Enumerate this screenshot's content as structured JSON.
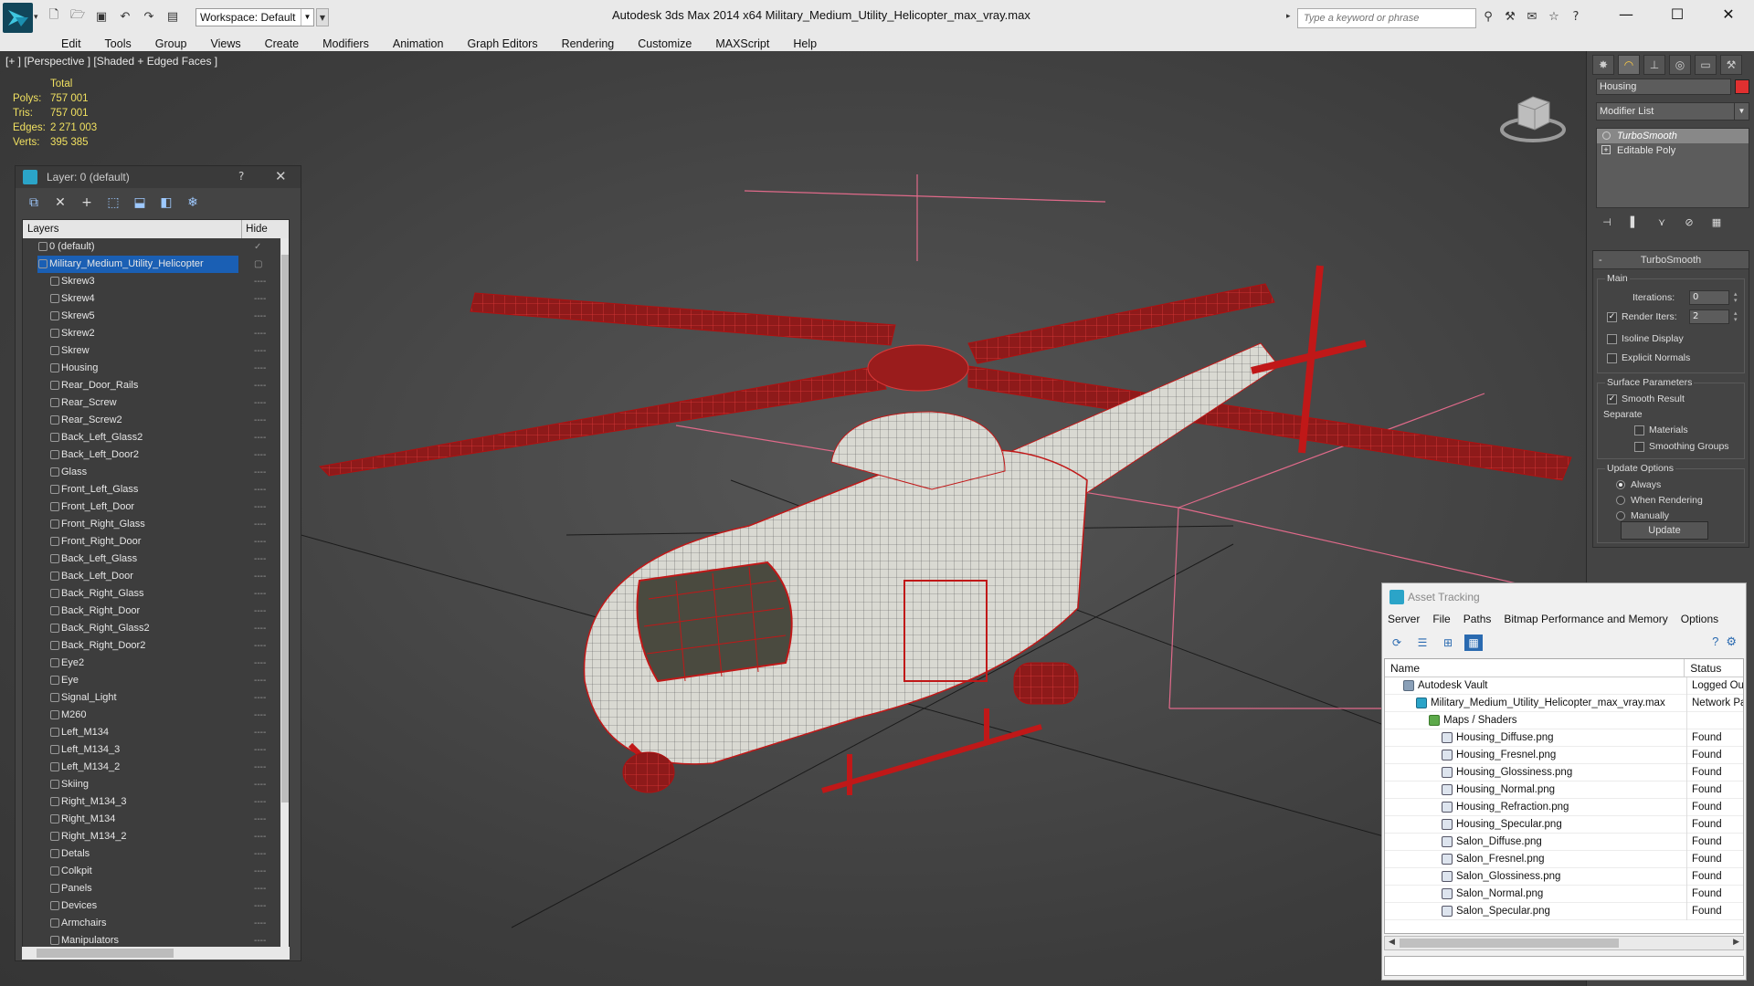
{
  "titlebar": {
    "workspace": "Workspace: Default",
    "app_title": "Autodesk 3ds Max  2014 x64      Military_Medium_Utility_Helicopter_max_vray.max",
    "search_placeholder": "Type a keyword or phrase"
  },
  "menu": [
    "Edit",
    "Tools",
    "Group",
    "Views",
    "Create",
    "Modifiers",
    "Animation",
    "Graph Editors",
    "Rendering",
    "Customize",
    "MAXScript",
    "Help"
  ],
  "viewport": {
    "label": "[+ ] [Perspective ] [Shaded + Edged Faces ]",
    "stats_header": "Total",
    "stats": [
      {
        "k": "Polys:",
        "v": "757 001"
      },
      {
        "k": "Tris:",
        "v": "757 001"
      },
      {
        "k": "Edges:",
        "v": "2 271 003"
      },
      {
        "k": "Verts:",
        "v": "395 385"
      }
    ]
  },
  "layer_panel": {
    "title": "Layer: 0 (default)",
    "help": "?",
    "col_layers": "Layers",
    "col_hide": "Hide",
    "layers": [
      {
        "name": "0 (default)",
        "level": 0,
        "hide": "✓"
      },
      {
        "name": "Military_Medium_Utility_Helicopter",
        "level": 0,
        "selected": true,
        "hide": "▢"
      },
      {
        "name": "Skrew3",
        "level": 1,
        "hide": "----"
      },
      {
        "name": "Skrew4",
        "level": 1,
        "hide": "----"
      },
      {
        "name": "Skrew5",
        "level": 1,
        "hide": "----"
      },
      {
        "name": "Skrew2",
        "level": 1,
        "hide": "----"
      },
      {
        "name": "Skrew",
        "level": 1,
        "hide": "----"
      },
      {
        "name": "Housing",
        "level": 1,
        "hide": "----"
      },
      {
        "name": "Rear_Door_Rails",
        "level": 1,
        "hide": "----"
      },
      {
        "name": "Rear_Screw",
        "level": 1,
        "hide": "----"
      },
      {
        "name": "Rear_Screw2",
        "level": 1,
        "hide": "----"
      },
      {
        "name": "Back_Left_Glass2",
        "level": 1,
        "hide": "----"
      },
      {
        "name": "Back_Left_Door2",
        "level": 1,
        "hide": "----"
      },
      {
        "name": "Glass",
        "level": 1,
        "hide": "----"
      },
      {
        "name": "Front_Left_Glass",
        "level": 1,
        "hide": "----"
      },
      {
        "name": "Front_Left_Door",
        "level": 1,
        "hide": "----"
      },
      {
        "name": "Front_Right_Glass",
        "level": 1,
        "hide": "----"
      },
      {
        "name": "Front_Right_Door",
        "level": 1,
        "hide": "----"
      },
      {
        "name": "Back_Left_Glass",
        "level": 1,
        "hide": "----"
      },
      {
        "name": "Back_Left_Door",
        "level": 1,
        "hide": "----"
      },
      {
        "name": "Back_Right_Glass",
        "level": 1,
        "hide": "----"
      },
      {
        "name": "Back_Right_Door",
        "level": 1,
        "hide": "----"
      },
      {
        "name": "Back_Right_Glass2",
        "level": 1,
        "hide": "----"
      },
      {
        "name": "Back_Right_Door2",
        "level": 1,
        "hide": "----"
      },
      {
        "name": "Eye2",
        "level": 1,
        "hide": "----"
      },
      {
        "name": "Eye",
        "level": 1,
        "hide": "----"
      },
      {
        "name": "Signal_Light",
        "level": 1,
        "hide": "----"
      },
      {
        "name": "M260",
        "level": 1,
        "hide": "----"
      },
      {
        "name": "Left_M134",
        "level": 1,
        "hide": "----"
      },
      {
        "name": "Left_M134_3",
        "level": 1,
        "hide": "----"
      },
      {
        "name": "Left_M134_2",
        "level": 1,
        "hide": "----"
      },
      {
        "name": "Skiing",
        "level": 1,
        "hide": "----"
      },
      {
        "name": "Right_M134_3",
        "level": 1,
        "hide": "----"
      },
      {
        "name": "Right_M134",
        "level": 1,
        "hide": "----"
      },
      {
        "name": "Right_M134_2",
        "level": 1,
        "hide": "----"
      },
      {
        "name": "Detals",
        "level": 1,
        "hide": "----"
      },
      {
        "name": "Colkpit",
        "level": 1,
        "hide": "----"
      },
      {
        "name": "Panels",
        "level": 1,
        "hide": "----"
      },
      {
        "name": "Devices",
        "level": 1,
        "hide": "----"
      },
      {
        "name": "Armchairs",
        "level": 1,
        "hide": "----"
      },
      {
        "name": "Manipulators",
        "level": 1,
        "hide": "----"
      }
    ]
  },
  "command_panel": {
    "object_name": "Housing",
    "object_color": "#e03030",
    "modifier_list": "Modifier List",
    "stack": [
      {
        "name": "TurboSmooth",
        "selected": true
      },
      {
        "name": "Editable Poly",
        "selected": false
      }
    ],
    "turbosmooth": {
      "title": "TurboSmooth",
      "main_label": "Main",
      "iterations_label": "Iterations:",
      "iterations": "0",
      "render_iters_label": "Render Iters:",
      "render_iters": "2",
      "isoline_label": "Isoline Display",
      "explicit_label": "Explicit Normals",
      "surface_label": "Surface Parameters",
      "smooth_label": "Smooth Result",
      "separate_label": "Separate",
      "materials_label": "Materials",
      "smoothing_groups_label": "Smoothing Groups",
      "update_options_label": "Update Options",
      "always_label": "Always",
      "when_rendering_label": "When Rendering",
      "manually_label": "Manually",
      "update_button": "Update"
    }
  },
  "asset_tracking": {
    "title": "Asset Tracking",
    "menu": [
      "Server",
      "File",
      "Paths",
      "Bitmap Performance and Memory",
      "Options"
    ],
    "col_name": "Name",
    "col_status": "Status",
    "rows": [
      {
        "name": "Autodesk Vault",
        "status": "Logged Out",
        "level": 0,
        "icon": "vault"
      },
      {
        "name": "Military_Medium_Utility_Helicopter_max_vray.max",
        "status": "Network Path",
        "level": 1,
        "icon": "max"
      },
      {
        "name": "Maps / Shaders",
        "status": "",
        "level": 2,
        "icon": "folder"
      },
      {
        "name": "Housing_Diffuse.png",
        "status": "Found",
        "level": 3,
        "icon": "file"
      },
      {
        "name": "Housing_Fresnel.png",
        "status": "Found",
        "level": 3,
        "icon": "file"
      },
      {
        "name": "Housing_Glossiness.png",
        "status": "Found",
        "level": 3,
        "icon": "file"
      },
      {
        "name": "Housing_Normal.png",
        "status": "Found",
        "level": 3,
        "icon": "file"
      },
      {
        "name": "Housing_Refraction.png",
        "status": "Found",
        "level": 3,
        "icon": "file"
      },
      {
        "name": "Housing_Specular.png",
        "status": "Found",
        "level": 3,
        "icon": "file"
      },
      {
        "name": "Salon_Diffuse.png",
        "status": "Found",
        "level": 3,
        "icon": "file"
      },
      {
        "name": "Salon_Fresnel.png",
        "status": "Found",
        "level": 3,
        "icon": "file"
      },
      {
        "name": "Salon_Glossiness.png",
        "status": "Found",
        "level": 3,
        "icon": "file"
      },
      {
        "name": "Salon_Normal.png",
        "status": "Found",
        "level": 3,
        "icon": "file"
      },
      {
        "name": "Salon_Specular.png",
        "status": "Found",
        "level": 3,
        "icon": "file"
      }
    ]
  },
  "colors": {
    "wire_red": "#c01818",
    "wire_white": "#f2f2f2",
    "gizmo_pink": "#e06a8a",
    "stats_yellow": "#f0e060",
    "selection_blue": "#1a5fb4"
  }
}
